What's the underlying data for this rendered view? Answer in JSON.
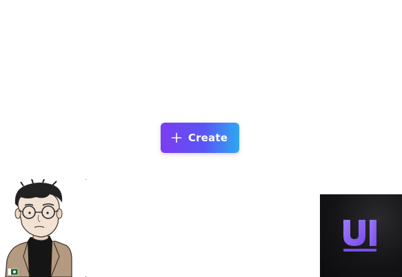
{
  "create_button": {
    "label": "Create",
    "icon": "plus-icon",
    "gradient": [
      "#7c3cf0",
      "#5a55f5",
      "#2fa8f2"
    ]
  },
  "avatar": {
    "icon": "avatar-illustration",
    "badge_icon": "flag-badge-icon"
  },
  "logo": {
    "text": "UI",
    "background": "#141416"
  }
}
